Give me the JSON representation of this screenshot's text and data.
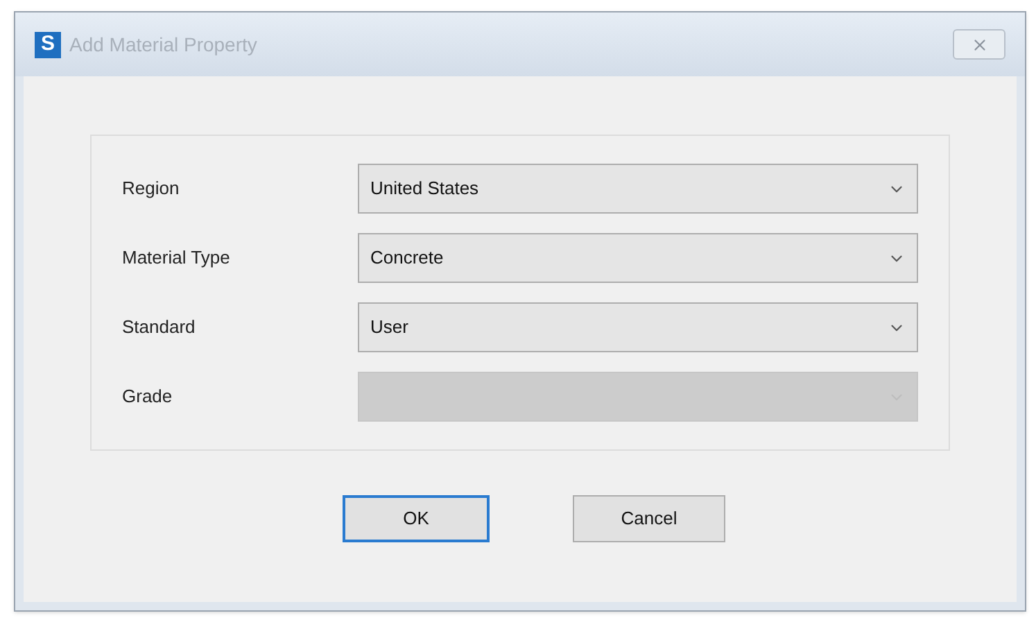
{
  "window": {
    "title": "Add Material Property",
    "icon_letter": "S"
  },
  "fields": [
    {
      "label": "Region",
      "value": "United States",
      "disabled": false
    },
    {
      "label": "Material Type",
      "value": "Concrete",
      "disabled": false
    },
    {
      "label": "Standard",
      "value": "User",
      "disabled": false
    },
    {
      "label": "Grade",
      "disabled": true
    }
  ],
  "buttons": [
    {
      "label": "OK",
      "default": true
    },
    {
      "label": "Cancel",
      "default": false
    }
  ]
}
